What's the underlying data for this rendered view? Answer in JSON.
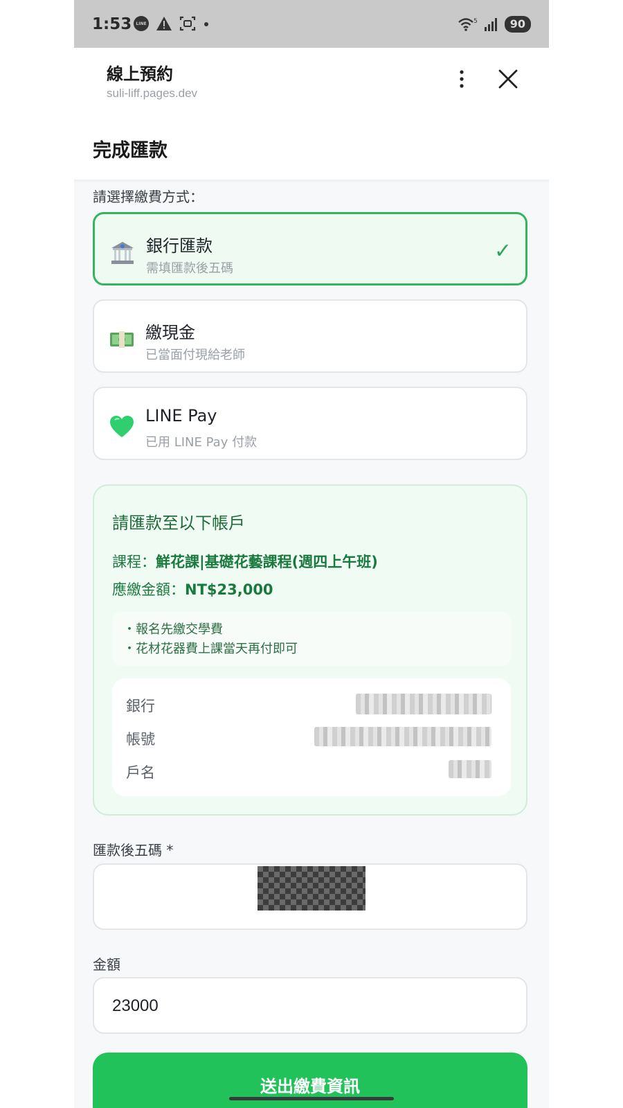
{
  "status_bar": {
    "time": "1:53",
    "battery": "90",
    "network_badge": "5",
    "line_icon_label": "LINE"
  },
  "header": {
    "title": "線上預約",
    "url": "suli-liff.pages.dev",
    "page_title": "完成匯款"
  },
  "payment": {
    "label": "請選擇繳費方式：",
    "options": [
      {
        "title": "銀行匯款",
        "subtitle": "需填匯款後五碼",
        "icon": "bank-icon",
        "selected": true,
        "check": "✓"
      },
      {
        "title": "繳現金",
        "subtitle": "已當面付現給老師",
        "icon": "cash-icon",
        "selected": false
      },
      {
        "title": "LINE Pay",
        "subtitle": "已用 LINE Pay 付款",
        "icon": "green-heart-icon",
        "selected": false
      }
    ]
  },
  "account": {
    "heading": "請匯款至以下帳戶",
    "course_label": "課程：",
    "course_value": "鮮花課|基礎花藝課程(週四上午班)",
    "amount_label": "應繳金額：",
    "amount_value": "NT$23,000",
    "notes": [
      "・報名先繳交學費",
      "・花材花器費上課當天再付即可"
    ],
    "rows": [
      {
        "label": "銀行"
      },
      {
        "label": "帳號"
      },
      {
        "label": "戶名"
      }
    ]
  },
  "form": {
    "last5_label": "匯款後五碼 *",
    "amount_label": "金額",
    "amount_value": "23000",
    "submit_label": "送出繳費資訊"
  },
  "colors": {
    "accent_green": "#22c25a",
    "selected_border": "#35b35d",
    "info_bg": "#effbf3"
  }
}
